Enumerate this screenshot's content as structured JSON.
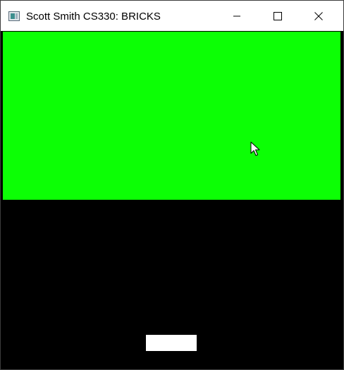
{
  "window": {
    "title": "Scott Smith CS330: BRICKS",
    "icon": "app-window-icon",
    "controls": {
      "minimize_icon": "minimize-icon",
      "maximize_icon": "maximize-icon",
      "close_icon": "close-icon"
    }
  },
  "game": {
    "background_color": "#000000",
    "brick_color": "#0cff05",
    "paddle_color": "#ffffff",
    "cursor_icon": "mouse-pointer-icon"
  }
}
